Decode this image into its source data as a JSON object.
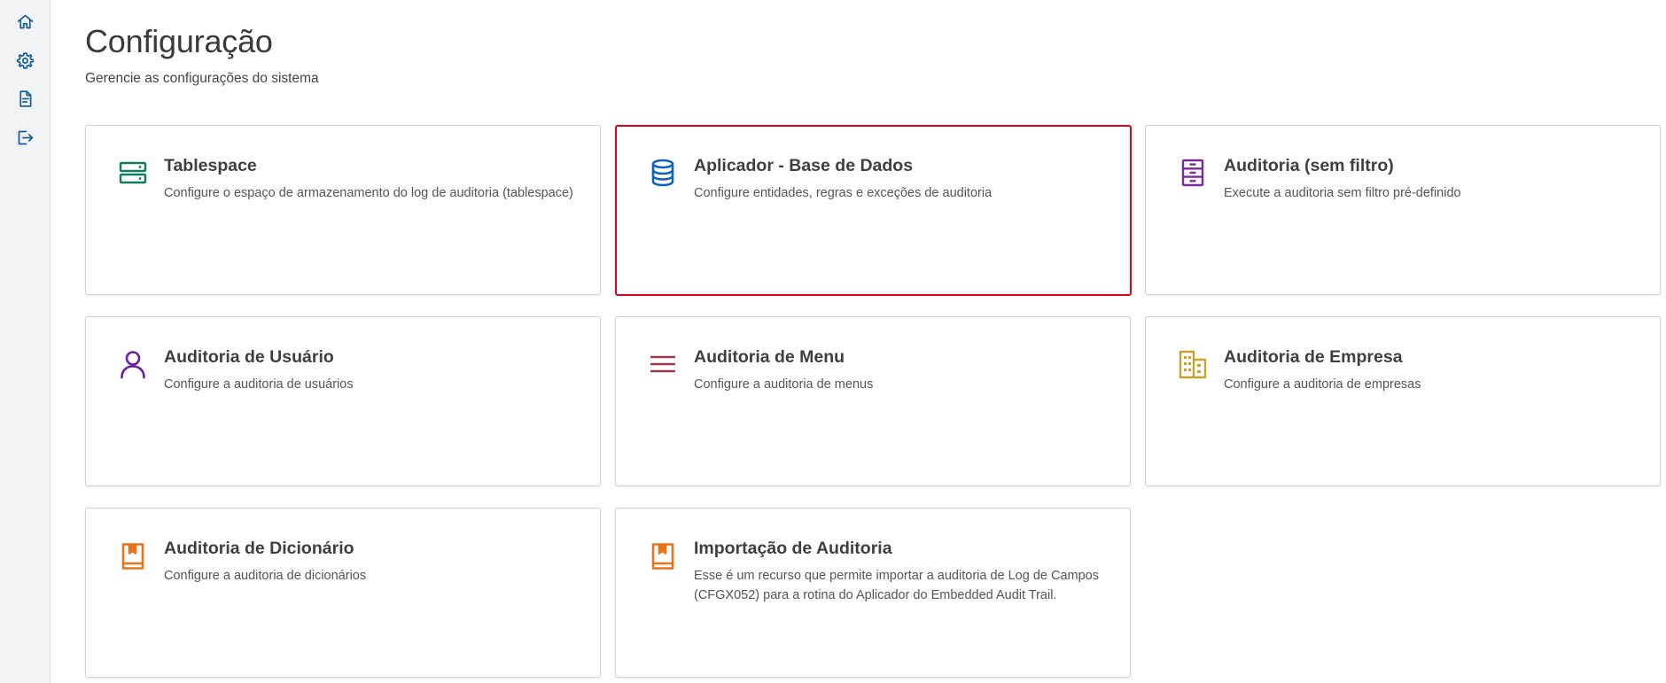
{
  "sidebar": {
    "items": [
      {
        "icon": "home-icon"
      },
      {
        "icon": "gear-icon"
      },
      {
        "icon": "document-icon"
      },
      {
        "icon": "logout-icon"
      }
    ],
    "accent": "#1a5f9c"
  },
  "header": {
    "title": "Configuração",
    "subtitle": "Gerencie as configurações do sistema"
  },
  "cards": [
    {
      "title": "Tablespace",
      "description": "Configure o espaço de armazenamento do log de auditoria (tablespace)",
      "icon": "server-icon",
      "color": "#0f7b5f"
    },
    {
      "title": "Aplicador - Base de Dados",
      "description": "Configure entidades, regras e exceções de auditoria",
      "icon": "database-icon",
      "color": "#0b63c1",
      "selected": true
    },
    {
      "title": "Auditoria (sem filtro)",
      "description": "Execute a auditoria sem filtro pré-definido",
      "icon": "cabinet-icon",
      "color": "#7b2a9c"
    },
    {
      "title": "Auditoria de Usuário",
      "description": "Configure a auditoria de usuários",
      "icon": "user-icon",
      "color": "#6a1fa6"
    },
    {
      "title": "Auditoria de Menu",
      "description": "Configure a auditoria de menus",
      "icon": "menu-icon",
      "color": "#9c3a50"
    },
    {
      "title": "Auditoria de Empresa",
      "description": "Configure a auditoria de empresas",
      "icon": "building-icon",
      "color": "#c9a328"
    },
    {
      "title": "Auditoria de Dicionário",
      "description": "Configure a auditoria de dicionários",
      "icon": "book-icon",
      "color": "#e8731a"
    },
    {
      "title": "Importação de Auditoria",
      "description": "Esse é um recurso que permite importar a auditoria de Log de Campos (CFGX052) para a rotina do Aplicador do Embedded Audit Trail.",
      "icon": "book-icon",
      "color": "#e8731a"
    }
  ],
  "colors": {
    "highlight_border": "#e0001b",
    "card_border": "#cfd3d6",
    "sidebar_bg": "#f2f3f4"
  }
}
